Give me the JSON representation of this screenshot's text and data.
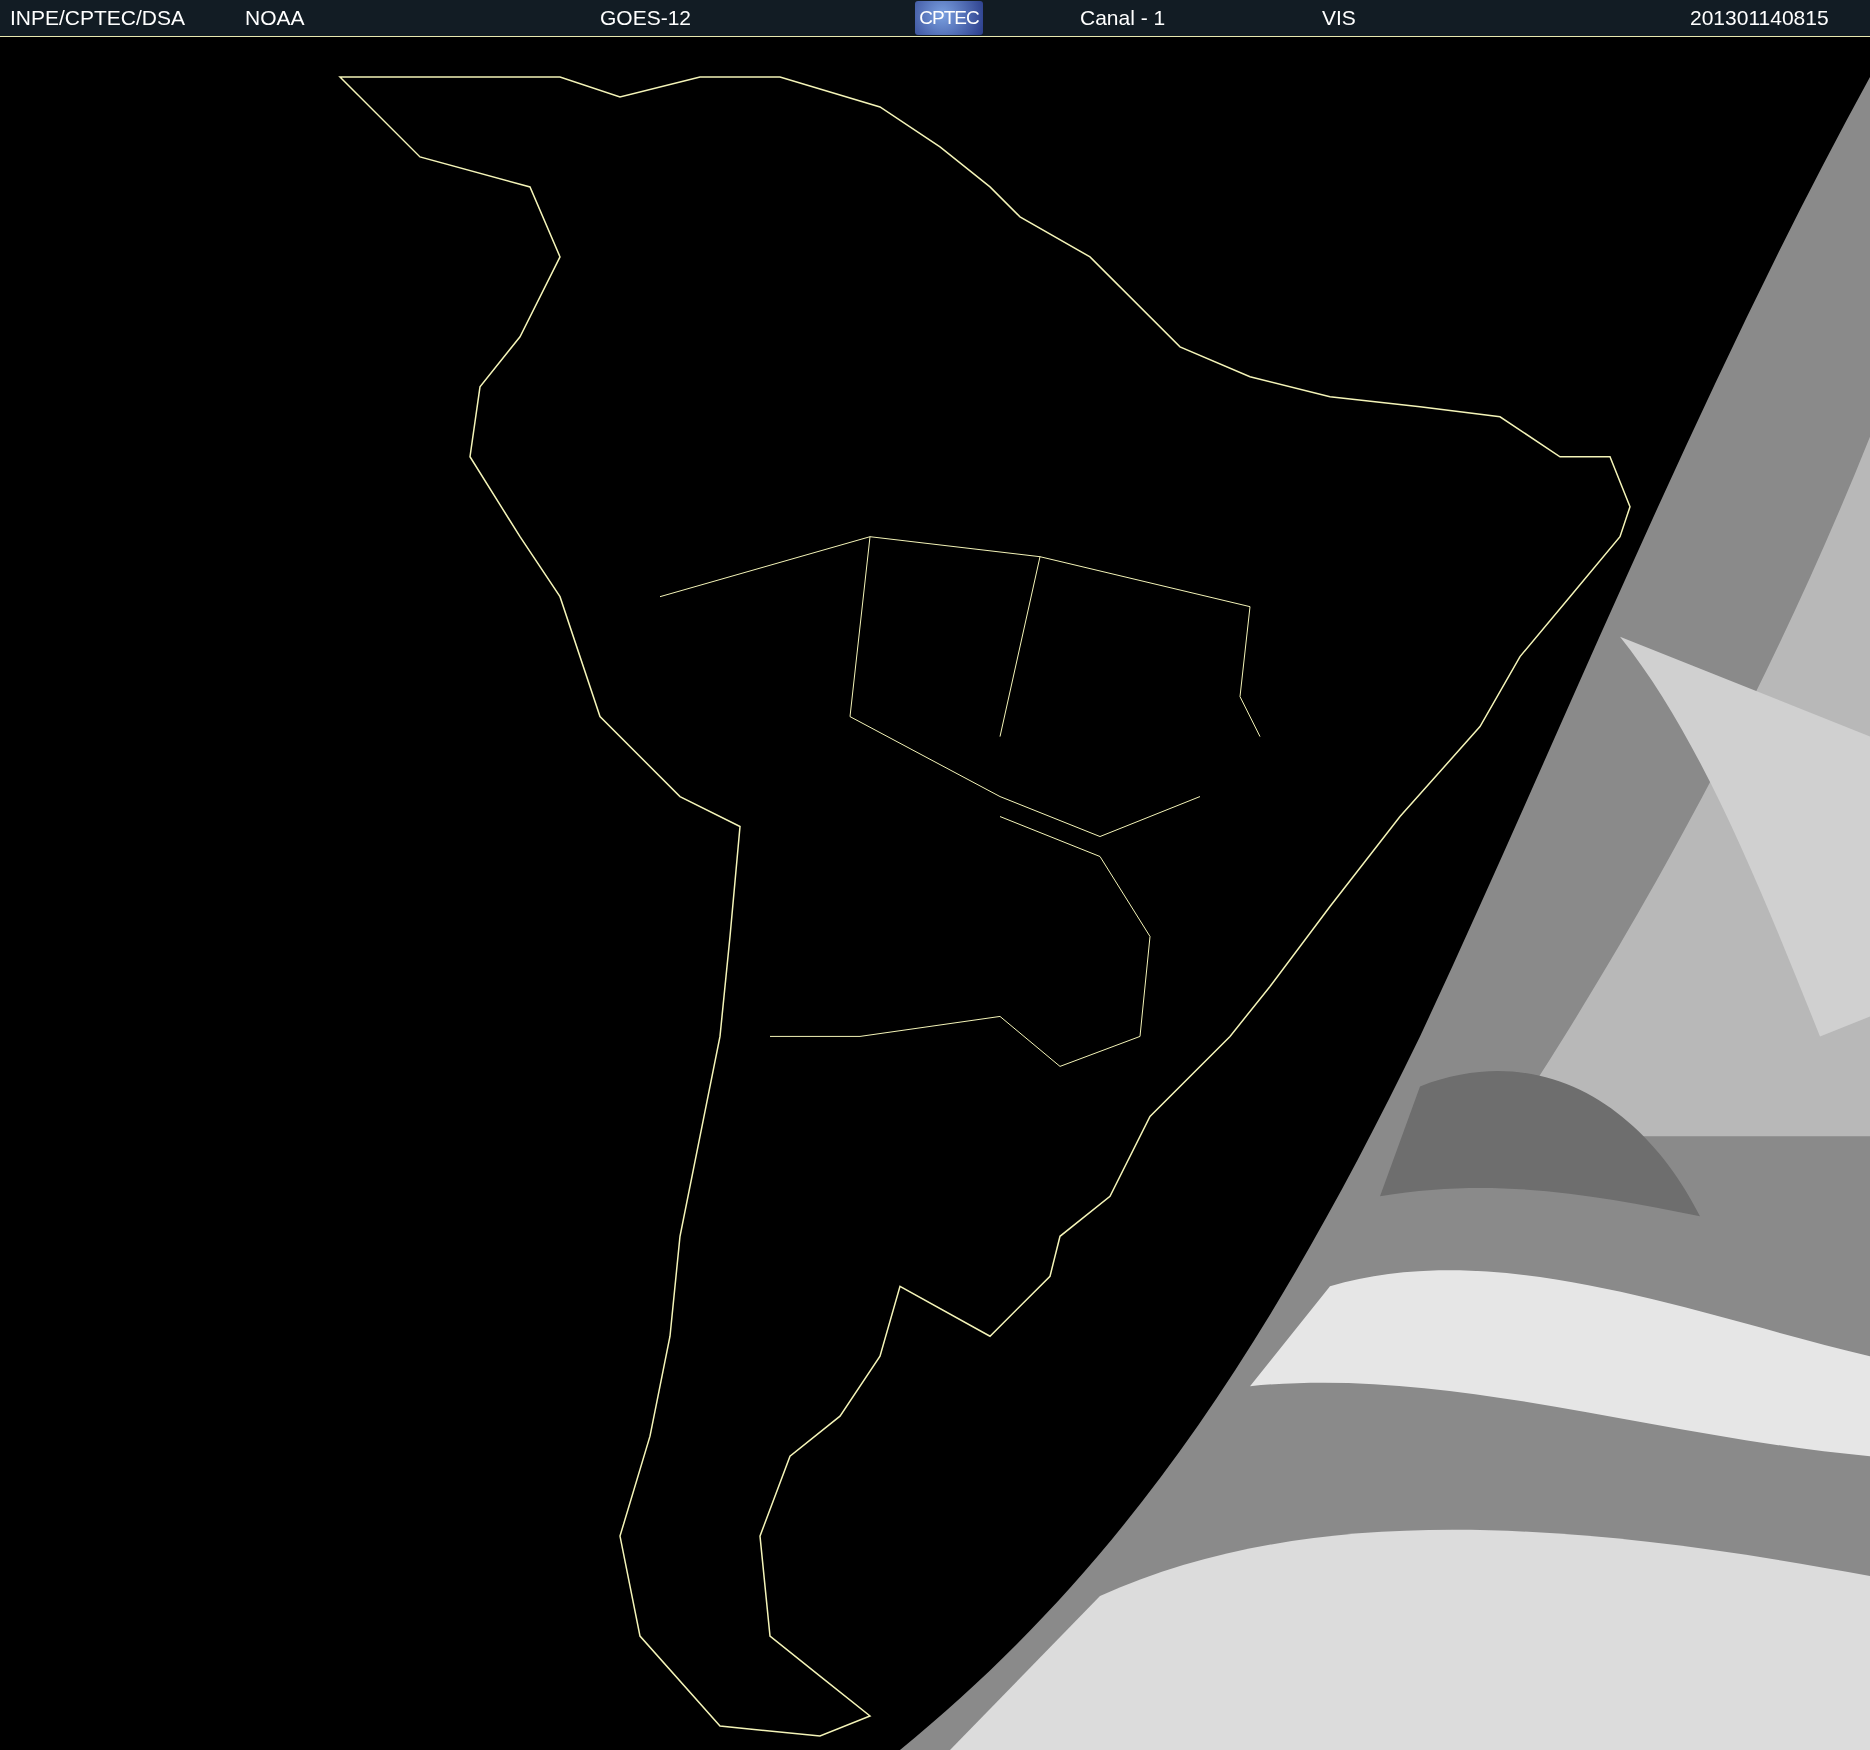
{
  "header": {
    "items": [
      {
        "kind": "text",
        "text": "INPE/CPTEC/DSA"
      },
      {
        "kind": "text",
        "text": "NOAA"
      },
      {
        "kind": "text",
        "text": "GOES-12"
      },
      {
        "kind": "logo",
        "text": "CPTEC"
      },
      {
        "kind": "text",
        "text": "Canal - 1"
      },
      {
        "kind": "text",
        "text": "VIS"
      },
      {
        "kind": "text",
        "text": "201301140815"
      }
    ]
  }
}
